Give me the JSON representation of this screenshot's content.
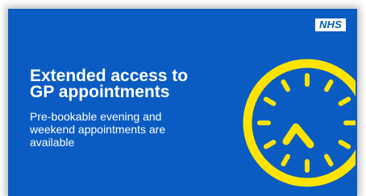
{
  "logo": {
    "text": "NHS"
  },
  "headline": {
    "lines": [
      "Extended access to",
      "GP appointments"
    ]
  },
  "body": {
    "lines": [
      "Pre-bookable evening and",
      "weekend appointments are",
      "available"
    ]
  },
  "colors": {
    "background": "#0a5cc2",
    "accent": "#ffe300",
    "text": "#ffffff",
    "logo_text": "#005eb8"
  },
  "icons": {
    "clock": "clock-icon"
  }
}
